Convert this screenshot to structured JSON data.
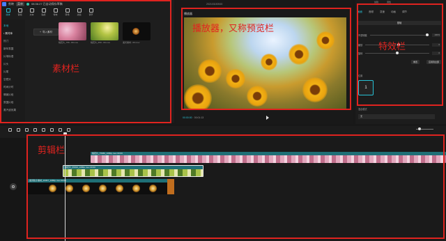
{
  "header": {
    "app_name": "剪映",
    "menu_label": "菜单",
    "autosave_text": "08:36:27 已自动保存草稿"
  },
  "tools": [
    {
      "label": "媒体",
      "icon": "media-icon",
      "active": true
    },
    {
      "label": "音频",
      "icon": "audio-icon"
    },
    {
      "label": "文本",
      "icon": "text-icon"
    },
    {
      "label": "贴纸",
      "icon": "sticker-icon"
    },
    {
      "label": "特效",
      "icon": "effect-icon"
    },
    {
      "label": "转场",
      "icon": "transition-icon"
    },
    {
      "label": "滤镜",
      "icon": "filter-icon"
    },
    {
      "label": "调节",
      "icon": "adjust-icon"
    }
  ],
  "sidebar": {
    "items": [
      {
        "label": "本地",
        "active": true
      },
      {
        "label": "• 素材库",
        "head": true
      },
      {
        "label": "热门"
      },
      {
        "label": "新年氛围"
      },
      {
        "label": "片场标语"
      },
      {
        "label": "片头"
      },
      {
        "label": "片尾"
      },
      {
        "label": "空镜头"
      },
      {
        "label": "时间计时"
      },
      {
        "label": "情景片段"
      },
      {
        "label": "氛围片段"
      },
      {
        "label": "蒸汽波效果"
      }
    ]
  },
  "assets": {
    "import_label": "导入素材",
    "items": [
      {
        "caption": "桃花片_756...80.mov"
      },
      {
        "caption": "桃花片_650...00.mov"
      },
      {
        "caption": "发光素材...00.mov"
      }
    ]
  },
  "annotations": {
    "assets": "素材栏",
    "player": "播放器，又称预览栏",
    "effects": "特效栏",
    "timeline": "剪辑栏"
  },
  "player": {
    "project_title": "202103150920",
    "panel_label": "播放器",
    "current_time": "00:00:00",
    "duration": "00:01:13"
  },
  "effects": {
    "header": [
      "剪辑",
      "调色"
    ],
    "tabs": [
      {
        "label": "画面",
        "active": true
      },
      {
        "label": "音频"
      },
      {
        "label": "变速"
      },
      {
        "label": "动画"
      },
      {
        "label": "调节"
      }
    ],
    "subtab": "基础",
    "rows": [
      {
        "label": "不透明度",
        "value": "100%",
        "knob": 0.96
      },
      {
        "label": "缩放",
        "value": "0",
        "knob": 0.52
      },
      {
        "label": "旋转",
        "value": "0",
        "knob": 0.5
      }
    ],
    "buttons": [
      "重置",
      "应用到全部"
    ],
    "position_label": "位置",
    "box_value": "1",
    "blend_label": "混合模式",
    "blend_value": "无"
  },
  "timeline": {
    "ruler": [
      "00:00",
      "00:10",
      "00:20",
      "00:30",
      "00:40",
      "00:50",
      "01:00",
      "01:10"
    ],
    "clips": [
      {
        "name": "桃花片_75680_1080p.mov  00:00"
      },
      {
        "name": "桃花片_65034_1080p.mov  00:00"
      },
      {
        "name": "发光粒子素材_16367_1080p.mov  00:00"
      }
    ]
  }
}
